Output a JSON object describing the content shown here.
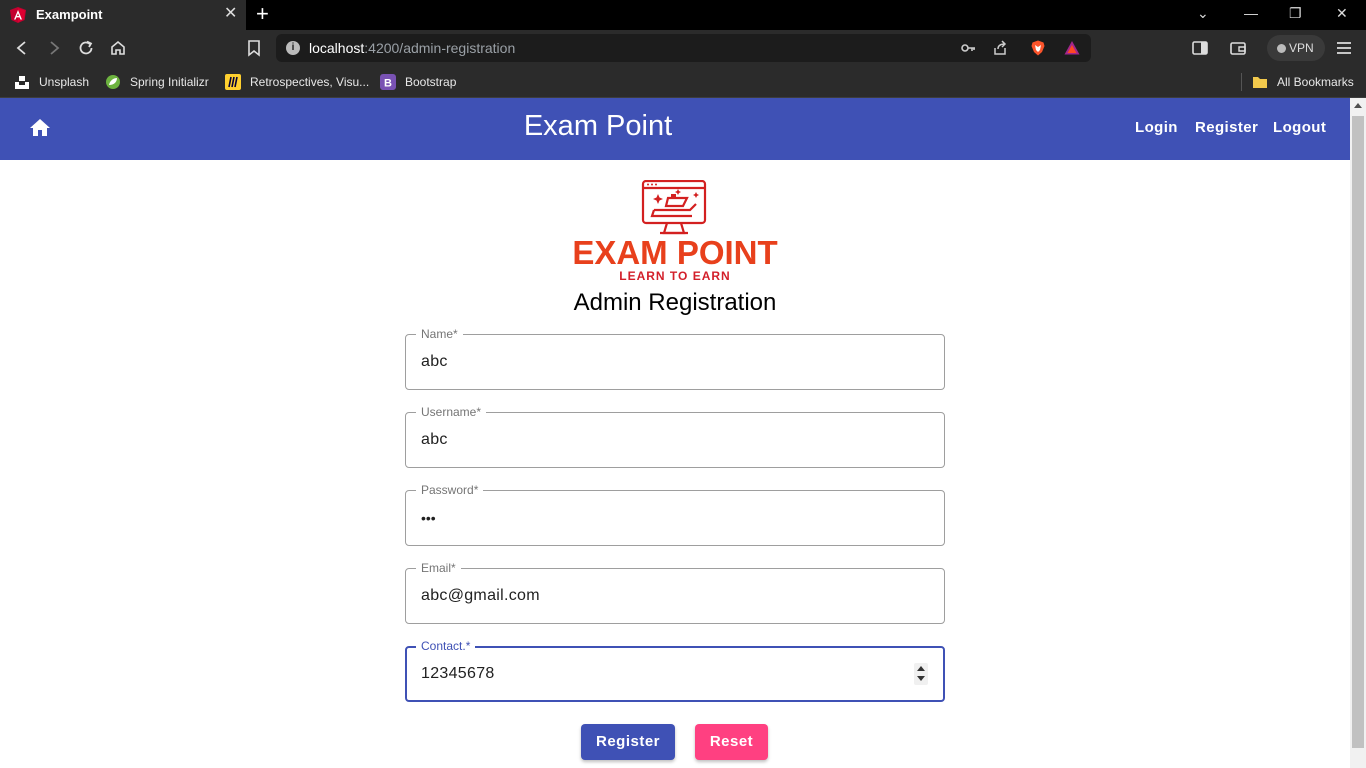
{
  "browser": {
    "tab_title": "Exampoint",
    "tab_close": "✕",
    "new_tab": "+",
    "window_controls": [
      "⌄",
      "—",
      "❐",
      "✕"
    ],
    "url_host": "localhost",
    "url_path": ":4200/admin-registration",
    "vpn_label": "VPN",
    "bookmarks": [
      {
        "label": "Unsplash",
        "icon": "unsplash-icon"
      },
      {
        "label": "Spring Initializr",
        "icon": "spring-icon"
      },
      {
        "label": "Retrospectives, Visu...",
        "icon": "miro-icon"
      },
      {
        "label": "Bootstrap",
        "icon": "bootstrap-icon"
      }
    ],
    "all_bookmarks": "All Bookmarks"
  },
  "app": {
    "title": "Exam Point",
    "nav": {
      "login": "Login",
      "register": "Register",
      "logout": "Logout"
    },
    "brand_color": "#3f51b5",
    "accent_color": "#ff4081"
  },
  "logo": {
    "name": "EXAM POINT",
    "tagline": "LEARN TO EARN"
  },
  "form": {
    "heading": "Admin Registration",
    "fields": [
      {
        "label": "Name*",
        "value": "abc"
      },
      {
        "label": "Username*",
        "value": "abc"
      },
      {
        "label": "Password*",
        "value": "•••"
      },
      {
        "label": "Email*",
        "value": "abc@gmail.com"
      },
      {
        "label": "Contact.*",
        "value": "12345678"
      }
    ],
    "register_button": "Register",
    "reset_button": "Reset"
  }
}
